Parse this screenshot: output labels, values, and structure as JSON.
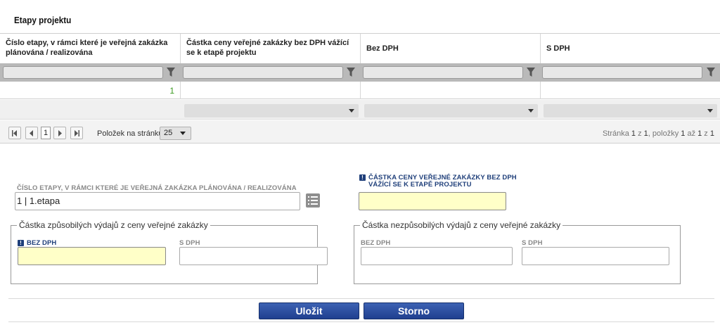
{
  "section_title": "Etapy projektu",
  "grid": {
    "columns": [
      "Číslo etapy, v rámci které je veřejná zakázka plánována / realizována",
      "Částka ceny veřejné zakázky bez DPH vážící se k etapě projektu",
      "Bez DPH",
      "S DPH"
    ],
    "rows": [
      [
        "1",
        "",
        "",
        ""
      ]
    ]
  },
  "pager": {
    "current_page": "1",
    "items_per_page_label": "Položek na stránku",
    "items_per_page": "25",
    "info_prefix": "Stránka ",
    "page": "1",
    "info_of": " z ",
    "pages": "1",
    "info_items": ", položky ",
    "from": "1",
    "info_to": " až ",
    "to": "1",
    "info_of2": " z ",
    "total": "1"
  },
  "form": {
    "stage_label": "Číslo etapy, v rámci které je veřejná zakázka plánována / realizována",
    "stage_value": "1 | 1.etapa",
    "amount_label_line1": "Částka ceny veřejné zakázky bez DPH",
    "amount_label_line2": "vážící se k etapě projektu",
    "amount_value": "",
    "eligible_legend": "Částka způsobilých výdajů z ceny veřejné zakázky",
    "eligible_bez_label": "Bez DPH",
    "eligible_s_label": "S DPH",
    "ineligible_legend": "Částka nezpůsobilých výdajů z ceny veřejné zakázky",
    "ineligible_bez_label": "Bez DPH",
    "ineligible_s_label": "S DPH"
  },
  "buttons": {
    "save": "Uložit",
    "cancel": "Storno"
  },
  "colors": {
    "required_fill": "#ffffc8",
    "button_blue": "#2a4d9e",
    "row_value_green": "#3a9a1f"
  }
}
